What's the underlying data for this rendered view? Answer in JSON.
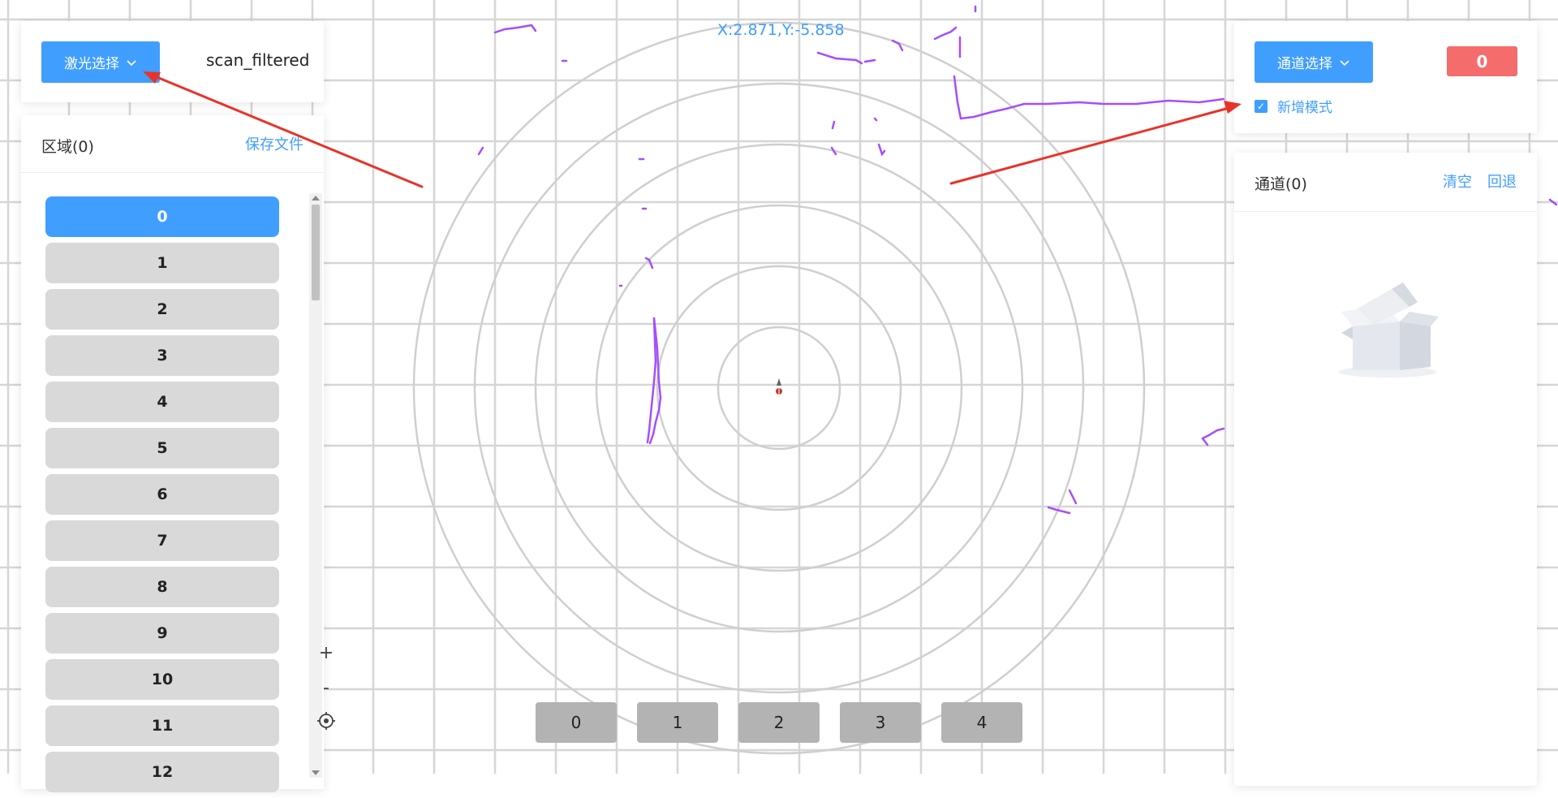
{
  "colors": {
    "primary": "#409eff",
    "danger": "#f56c6c",
    "grid": "#d6d6d6",
    "ring": "#cfcfcf",
    "scan_points": "#a64dff",
    "annotation_arrow": "#e8332a",
    "area_item_bg": "#d9d9d9",
    "channel_button_bg": "#b3b3b3"
  },
  "laser": {
    "select_label": "激光选择",
    "topic": "scan_filtered"
  },
  "area": {
    "title": "区域(0)",
    "save_label": "保存文件",
    "items": [
      "0",
      "1",
      "2",
      "3",
      "4",
      "5",
      "6",
      "7",
      "8",
      "9",
      "10",
      "11",
      "12"
    ],
    "active_index": 0
  },
  "zoom": {
    "in_label": "+",
    "out_label": "-",
    "locate_icon": "locate-icon"
  },
  "map": {
    "coordinate_readout": "X:2.871,Y:-5.858"
  },
  "channel_buttons": [
    "0",
    "1",
    "2",
    "3",
    "4"
  ],
  "channel": {
    "select_label": "通道选择",
    "count": "0",
    "add_mode_label": "新增模式",
    "add_mode_checked": true
  },
  "channels": {
    "title": "通道(0)",
    "clear_label": "清空",
    "undo_label": "回退",
    "empty_icon": "empty-box-icon"
  }
}
